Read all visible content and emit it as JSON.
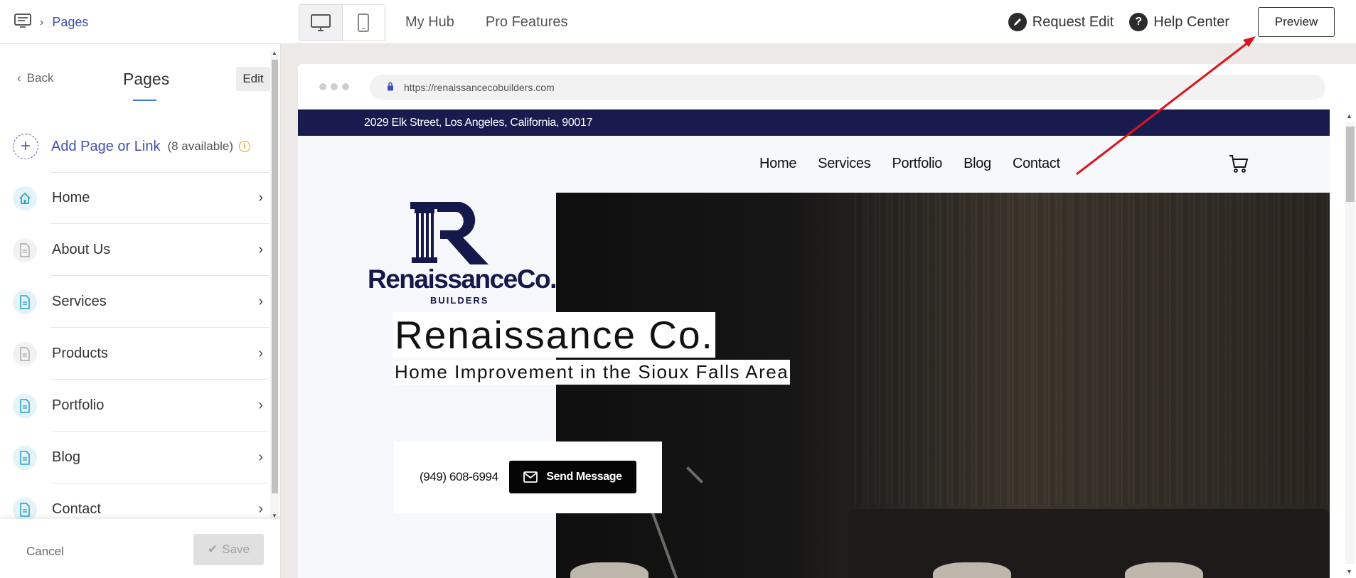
{
  "topbar": {
    "breadcrumb": "Pages",
    "nav": [
      "My Hub",
      "Pro Features"
    ],
    "request_edit": "Request Edit",
    "help_center": "Help Center",
    "preview": "Preview"
  },
  "sidebar": {
    "back": "Back",
    "title": "Pages",
    "edit": "Edit",
    "add_label": "Add Page or Link",
    "add_count": "(8 available)",
    "items": [
      {
        "label": "Home",
        "icon": "home-icon"
      },
      {
        "label": "About Us",
        "icon": "page-icon"
      },
      {
        "label": "Services",
        "icon": "page-icon"
      },
      {
        "label": "Products",
        "icon": "page-icon"
      },
      {
        "label": "Portfolio",
        "icon": "page-icon"
      },
      {
        "label": "Blog",
        "icon": "page-icon"
      },
      {
        "label": "Contact",
        "icon": "page-icon"
      }
    ],
    "cancel": "Cancel",
    "save": "Save"
  },
  "browser": {
    "url": "https://renaissancecobuilders.com"
  },
  "site": {
    "address": "2029 Elk Street, Los Angeles, California, 90017",
    "nav": [
      "Home",
      "Services",
      "Portfolio",
      "Blog",
      "Contact"
    ],
    "logo_word": "RenaissanceCo.",
    "logo_sub": "BUILDERS",
    "hero_title": "Renaissance Co.",
    "hero_subtitle": "Home Improvement in the Sioux Falls Area",
    "phone": "(949) 608-6994",
    "cta": "Send Message"
  },
  "colors": {
    "accent": "#3e4fb3",
    "brand_navy": "#191b4f",
    "annotation_red": "#d9161c"
  }
}
